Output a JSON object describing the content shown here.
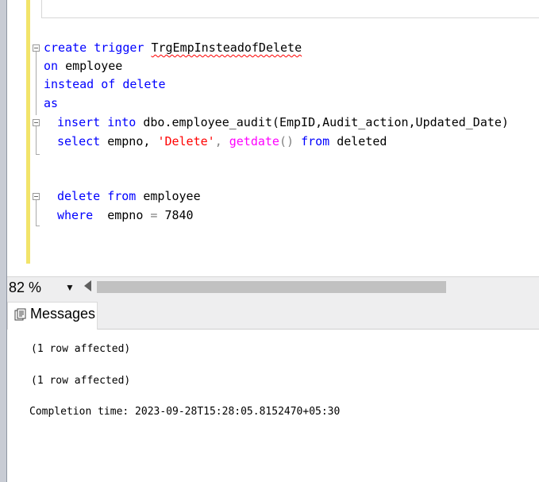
{
  "editor": {
    "code": {
      "line1": {
        "kw1": "create",
        "kw2": "trigger",
        "name": "TrgEmpInsteadofDelete"
      },
      "line2": {
        "kw": "on",
        "rest": "employee"
      },
      "line3": {
        "kw": "instead of delete"
      },
      "line4": {
        "kw": "as"
      },
      "line5": {
        "kw1": "insert",
        "kw2": "into",
        "rest": "dbo.employee_audit(EmpID,Audit_action,Updated_Date)"
      },
      "line6": {
        "kw": "select",
        "mid": "empno,",
        "str": "'Delete'",
        "comma": ",",
        "fn": "getdate",
        "paren": "()",
        "kw2": "from",
        "rest": "deleted"
      },
      "line7": {
        "kw1": "delete",
        "kw2": "from",
        "rest": "employee"
      },
      "line8": {
        "kw": "where",
        "rest": "empno",
        "op": "=",
        "num": "7840"
      }
    }
  },
  "statusbar": {
    "zoom": "82 %"
  },
  "results": {
    "tab_label": "Messages",
    "messages": [
      "(1 row affected)",
      "(1 row affected)",
      "Completion time: 2023-09-28T15:28:05.8152470+05:30"
    ]
  },
  "colors": {
    "keyword": "#0000ff",
    "string": "#ff0000",
    "function": "#ff00ff",
    "change_bar": "#f2e46a"
  }
}
